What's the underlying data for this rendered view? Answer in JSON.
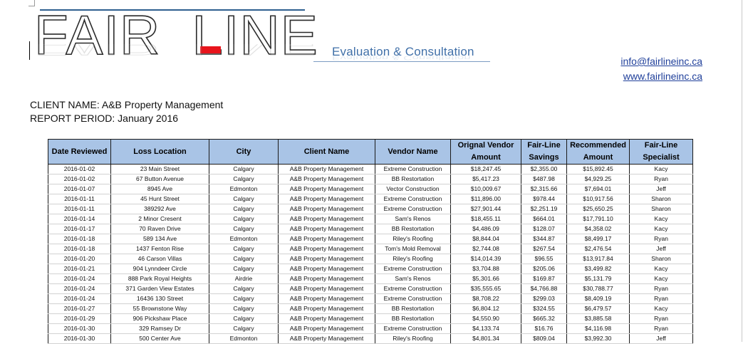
{
  "logo": {
    "text_left": "FAIR",
    "text_right": "LINE",
    "tagline": "Evaluation & Consultation"
  },
  "contact": {
    "email": "info@fairlineinc.ca",
    "website": "www.fairlineinc.ca"
  },
  "client": {
    "name_line": "CLIENT NAME:  A&B Property Management",
    "period_line": "REPORT PERIOD:  January 2016"
  },
  "colors": {
    "header_fill": "#a9c4e6",
    "logo_dash": "#e8141c",
    "tagline": "#3f6fa8",
    "link": "#1f3f9a"
  },
  "table": {
    "headers": [
      "Date Reviewed",
      "Loss Location",
      "City",
      "Client Name",
      "Vendor Name",
      "Orignal Vendor Amount",
      "Fair-Line Savings",
      "Recommended Amount",
      "Fair-Line Specialist"
    ],
    "rows": [
      [
        "2016-01-02",
        "23 Main Street",
        "Calgary",
        "A&B Property Management",
        "Extreme Construction",
        "$18,247.45",
        "$2,355.00",
        "$15,892.45",
        "Kacy"
      ],
      [
        "2016-01-02",
        "67 Button Avenue",
        "Calgary",
        "A&B Property Management",
        "BB Restortation",
        "$5,417.23",
        "$487.98",
        "$4,929.25",
        "Ryan"
      ],
      [
        "2016-01-07",
        "8945 Ave",
        "Edmonton",
        "A&B Property Management",
        "Vector Construction",
        "$10,009.67",
        "$2,315.66",
        "$7,694.01",
        "Jeff"
      ],
      [
        "2016-01-11",
        "45 Hunt Street",
        "Calgary",
        "A&B Property Management",
        "Extreme Construction",
        "$11,896.00",
        "$978.44",
        "$10,917.56",
        "Sharon"
      ],
      [
        "2016-01-11",
        "389292 Ave",
        "Calgary",
        "A&B Property Management",
        "Extreme Construction",
        "$27,901.44",
        "$2,251.19",
        "$25,650.25",
        "Sharon"
      ],
      [
        "2016-01-14",
        "2 Minor Cresent",
        "Calgary",
        "A&B Property Management",
        "Sam's Renos",
        "$18,455.11",
        "$664.01",
        "$17,791.10",
        "Kacy"
      ],
      [
        "2016-01-17",
        "70 Raven Drive",
        "Calgary",
        "A&B Property Management",
        "BB Restortation",
        "$4,486.09",
        "$128.07",
        "$4,358.02",
        "Kacy"
      ],
      [
        "2016-01-18",
        "589 134 Ave",
        "Edmonton",
        "A&B Property Management",
        "Riley's Roofing",
        "$8,844.04",
        "$344.87",
        "$8,499.17",
        "Ryan"
      ],
      [
        "2016-01-18",
        "1437 Fenton Rise",
        "Calgary",
        "A&B Property Management",
        "Tom's Mold Removal",
        "$2,744.08",
        "$267.54",
        "$2,476.54",
        "Jeff"
      ],
      [
        "2016-01-20",
        "46 Carson Villas",
        "Calgary",
        "A&B Property Management",
        "Riley's Roofing",
        "$14,014.39",
        "$96.55",
        "$13,917.84",
        "Sharon"
      ],
      [
        "2016-01-21",
        "904 Lynndeer Circle",
        "Calgary",
        "A&B Property Management",
        "Extreme Construction",
        "$3,704.88",
        "$205.06",
        "$3,499.82",
        "Kacy"
      ],
      [
        "2016-01-24",
        "888 Park Royal Heights",
        "Airdrie",
        "A&B Property Management",
        "Sam's Renos",
        "$5,301.66",
        "$169.87",
        "$5,131.79",
        "Kacy"
      ],
      [
        "2016-01-24",
        "371 Garden View Estates",
        "Calgary",
        "A&B Property Management",
        "Extreme Construction",
        "$35,555.65",
        "$4,766.88",
        "$30,788.77",
        "Ryan"
      ],
      [
        "2016-01-24",
        "16436 130 Street",
        "Calgary",
        "A&B Property Management",
        "Extreme Construction",
        "$8,708.22",
        "$299.03",
        "$8,409.19",
        "Ryan"
      ],
      [
        "2016-01-27",
        "55 Brownstone Way",
        "Calgary",
        "A&B Property Management",
        "BB Restortation",
        "$6,804.12",
        "$324.55",
        "$6,479.57",
        "Kacy"
      ],
      [
        "2016-01-29",
        "906 Pickshaw Place",
        "Calgary",
        "A&B Property Management",
        "BB Restortation",
        "$4,550.90",
        "$665.32",
        "$3,885.58",
        "Ryan"
      ],
      [
        "2016-01-30",
        "329 Ramsey Dr",
        "Calgary",
        "A&B Property Management",
        "Extreme Construction",
        "$4,133.74",
        "$16.76",
        "$4,116.98",
        "Ryan"
      ],
      [
        "2016-01-30",
        "500 Center Ave",
        "Edmonton",
        "A&B Property Management",
        "Riley's Roofing",
        "$4,801.34",
        "$809.04",
        "$3,992.30",
        "Jeff"
      ]
    ]
  }
}
